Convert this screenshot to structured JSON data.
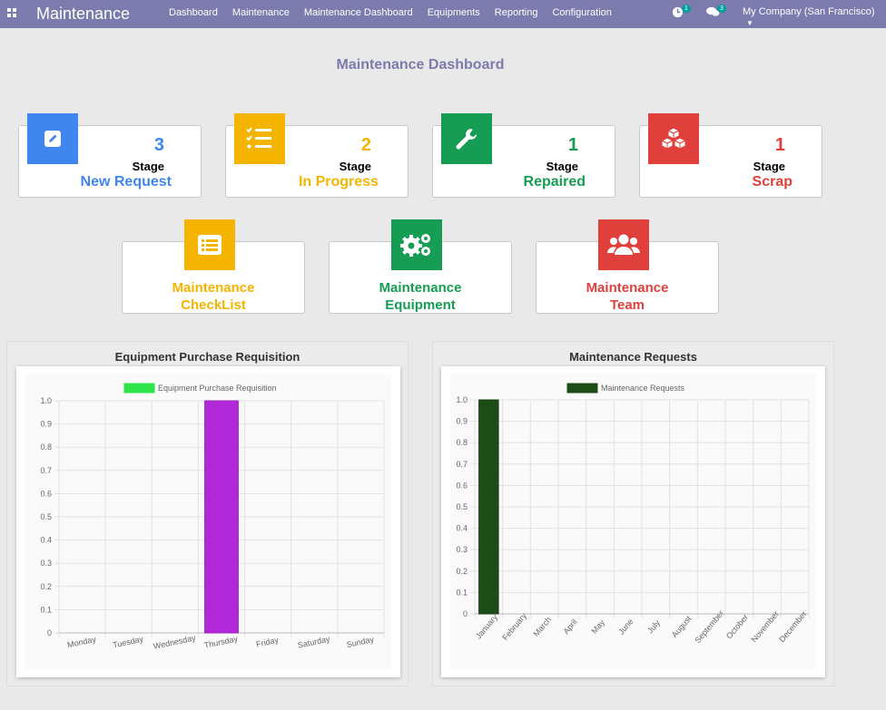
{
  "navbar": {
    "app_title": "Maintenance",
    "menu": [
      "Dashboard",
      "Maintenance",
      "Maintenance Dashboard",
      "Equipments",
      "Reporting",
      "Configuration"
    ],
    "activity_count": "1",
    "message_count": "3",
    "company": "My Company (San Francisco)"
  },
  "page_title": "Maintenance Dashboard",
  "stages": [
    {
      "count": "3",
      "stage_label": "Stage",
      "name": "New Request",
      "color": "#3f86ef",
      "icon": "pencil-icon"
    },
    {
      "count": "2",
      "stage_label": "Stage",
      "name": "In Progress",
      "color": "#f5b400",
      "icon": "checklist-icon"
    },
    {
      "count": "1",
      "stage_label": "Stage",
      "name": "Repaired",
      "color": "#169d53",
      "icon": "wrench-icon"
    },
    {
      "count": "1",
      "stage_label": "Stage",
      "name": "Scrap",
      "color": "#e0403b",
      "icon": "cubes-icon"
    }
  ],
  "shortcuts": [
    {
      "line1": "Maintenance",
      "line2": "CheckList",
      "color": "#f5b400",
      "icon": "list-alt-icon"
    },
    {
      "line1": "Maintenance",
      "line2": "Equipment",
      "color": "#169d53",
      "icon": "gears-icon"
    },
    {
      "line1": "Maintenance",
      "line2": "Team",
      "color": "#e0403b",
      "icon": "users-icon"
    }
  ],
  "chart_data": [
    {
      "type": "bar",
      "title": "Equipment Purchase Requisition",
      "categories": [
        "Monday",
        "Tuesday",
        "Wednesday",
        "Thursday",
        "Friday",
        "Saturday",
        "Sunday"
      ],
      "series": [
        {
          "name": "Equipment Purchase Requisition",
          "values": [
            0,
            0,
            0,
            1,
            0,
            0,
            0
          ],
          "color": "#b128d8",
          "legend_color": "#2fe34a"
        }
      ],
      "yticks": [
        "0",
        "0.1",
        "0.2",
        "0.3",
        "0.4",
        "0.5",
        "0.6",
        "0.7",
        "0.8",
        "0.9",
        "1.0"
      ],
      "ylim": [
        0,
        1
      ],
      "legend": "top-center",
      "grid": true
    },
    {
      "type": "bar",
      "title": "Maintenance Requests",
      "categories": [
        "January",
        "February",
        "March",
        "April",
        "May",
        "June",
        "July",
        "August",
        "September",
        "October",
        "November",
        "December"
      ],
      "series": [
        {
          "name": "Maintenance Requests",
          "values": [
            1,
            0,
            0,
            0,
            0,
            0,
            0,
            0,
            0,
            0,
            0,
            0
          ],
          "color": "#1d4d17",
          "legend_color": "#1d4d17"
        }
      ],
      "yticks": [
        "0",
        "0.1",
        "0.2",
        "0.3",
        "0.4",
        "0.5",
        "0.6",
        "0.7",
        "0.8",
        "0.9",
        "1.0"
      ],
      "ylim": [
        0,
        1
      ],
      "legend": "top-center",
      "grid": true
    }
  ]
}
